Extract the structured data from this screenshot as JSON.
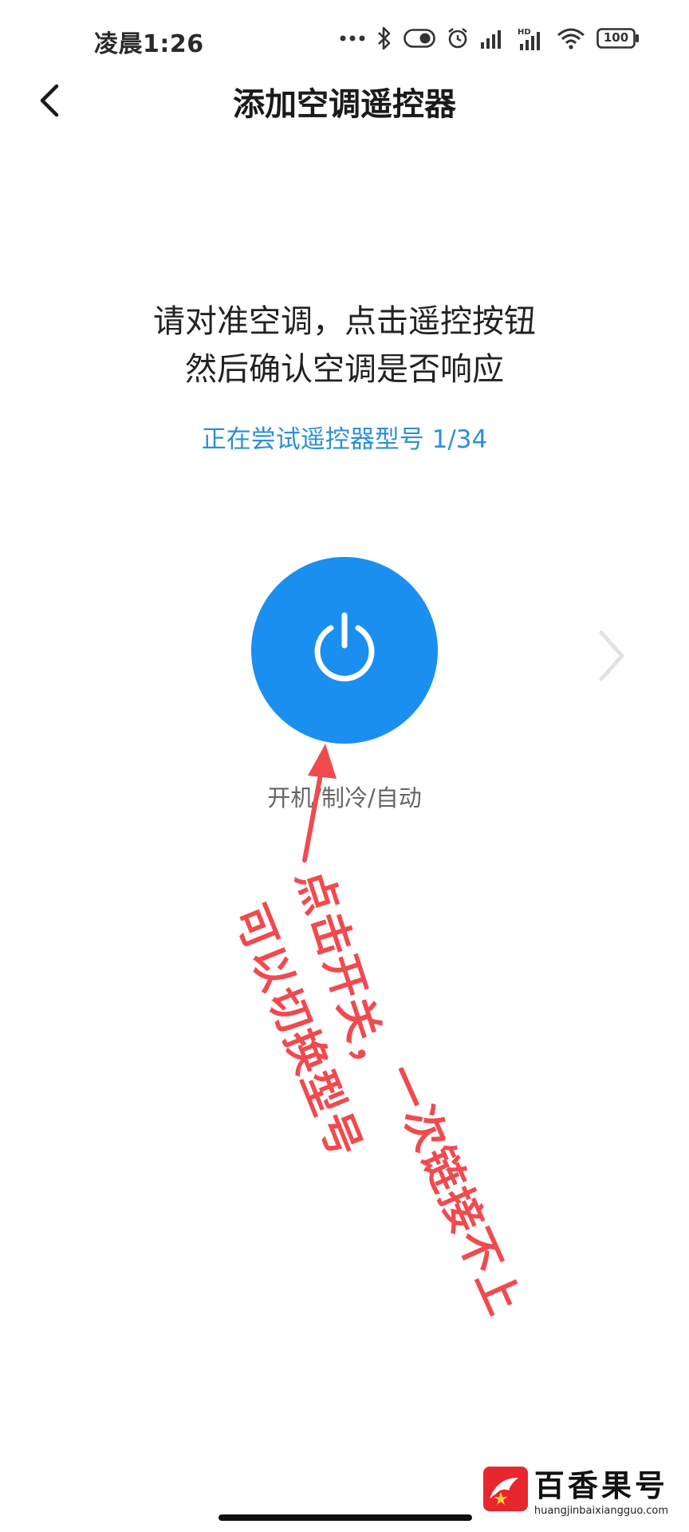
{
  "status_bar": {
    "time": "凌晨1:26",
    "battery": "100",
    "icons": [
      "more-dots-icon",
      "bluetooth-icon",
      "toggle-icon",
      "alarm-icon",
      "signal-icon",
      "hd-signal-icon",
      "wifi-icon",
      "battery-icon"
    ]
  },
  "nav": {
    "title": "添加空调遥控器",
    "back_icon": "chevron-left-icon"
  },
  "instruction": {
    "line1": "请对准空调，点击遥控按钮",
    "line2": "然后确认空调是否响应"
  },
  "trying": "正在尝试遥控器型号 1/34",
  "power_button": {
    "icon": "power-icon",
    "label": "开机/制冷/自动"
  },
  "next_icon": "chevron-right-icon",
  "annotation": {
    "text1": "点击开关，",
    "text2": "可以切换型号",
    "text3": "一次链接不上"
  },
  "watermark": {
    "brand": "百香果号",
    "url": "huangjinbaixiangguo.com"
  },
  "colors": {
    "accent": "#1b8ff0",
    "trying_text": "#2f8fd8",
    "annotation": "#f04a4f",
    "watermark_red": "#e8262d"
  }
}
